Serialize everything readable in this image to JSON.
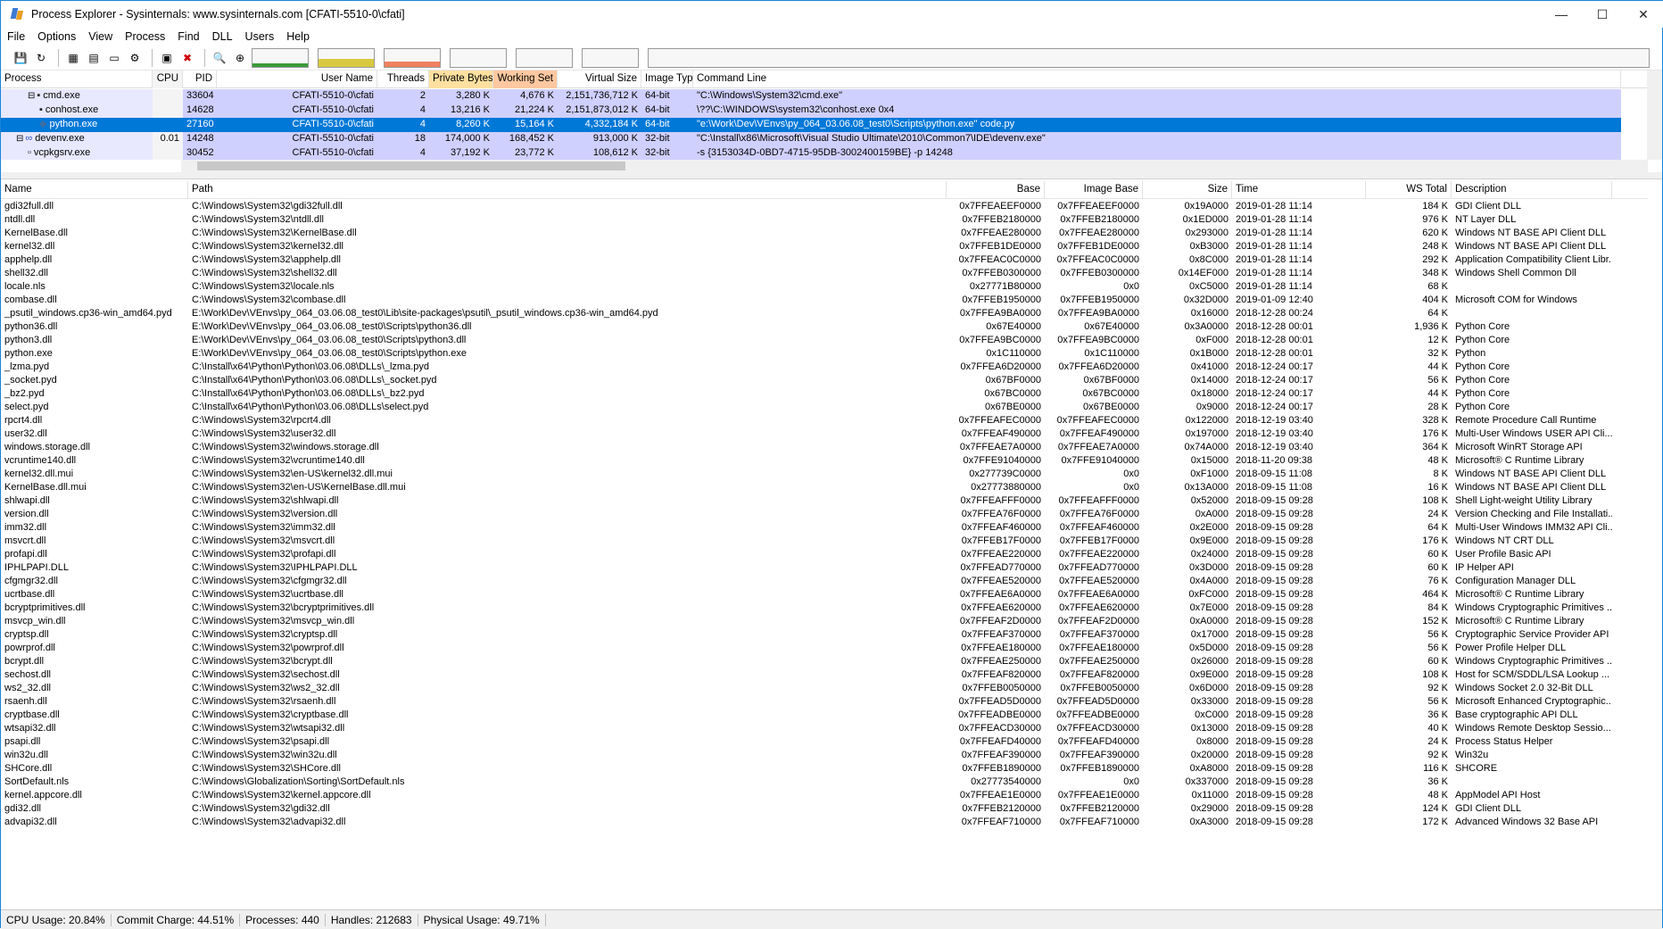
{
  "window": {
    "title": "Process Explorer - Sysinternals: www.sysinternals.com [CFATI-5510-0\\cfati]",
    "minimize": "—",
    "maximize": "☐",
    "close": "✕"
  },
  "menu": [
    "File",
    "Options",
    "View",
    "Process",
    "Find",
    "DLL",
    "Users",
    "Help"
  ],
  "toolbar": {
    "icons": [
      "save-icon",
      "refresh-icon",
      "system-info-icon",
      "properties-icon",
      "window-icon",
      "dll-icon",
      "options-icon",
      "kill-process-icon",
      "find-icon",
      "target-icon"
    ],
    "graphs": [
      {
        "name": "cpu-graph",
        "color": "#3a9a3a",
        "level": 0.2
      },
      {
        "name": "commit-graph",
        "color": "#d8c840",
        "level": 0.45
      },
      {
        "name": "io-graph",
        "color": "#f08060",
        "level": 0.3
      },
      {
        "name": "network-graph",
        "color": "#a0a0a0",
        "level": 0
      },
      {
        "name": "disk-graph",
        "color": "#a0a0a0",
        "level": 0
      },
      {
        "name": "gpu-graph",
        "color": "#a0a0a0",
        "level": 0
      }
    ]
  },
  "process_table": {
    "headers": [
      "Process",
      "CPU",
      "PID",
      "User Name",
      "Threads",
      "Private Bytes",
      "Working Set",
      "Virtual Size",
      "Image Type",
      "Command Line"
    ],
    "rows": [
      {
        "name": "cmd.exe",
        "indent": 2,
        "toggle": "⊟",
        "icon": "cmd-icon",
        "cpu": "",
        "pid": "33604",
        "user": "CFATI-5510-0\\cfati",
        "threads": "2",
        "private": "3,280 K",
        "working": "4,676 K",
        "virtual": "2,151,736,712 K",
        "type": "64-bit",
        "cmd": "\"C:\\Windows\\System32\\cmd.exe\"",
        "style": "purple"
      },
      {
        "name": "conhost.exe",
        "indent": 3,
        "toggle": "",
        "icon": "console-icon",
        "cpu": "",
        "pid": "14628",
        "user": "CFATI-5510-0\\cfati",
        "threads": "4",
        "private": "13,216 K",
        "working": "21,224 K",
        "virtual": "2,151,873,012 K",
        "type": "64-bit",
        "cmd": "\\??\\C:\\WINDOWS\\system32\\conhost.exe 0x4",
        "style": "purple"
      },
      {
        "name": "python.exe",
        "indent": 3,
        "toggle": "",
        "icon": "python-icon",
        "cpu": "",
        "pid": "27160",
        "user": "CFATI-5510-0\\cfati",
        "threads": "4",
        "private": "8,260 K",
        "working": "15,164 K",
        "virtual": "4,332,184 K",
        "type": "64-bit",
        "cmd": "\"e:\\Work\\Dev\\VEnvs\\py_064_03.06.08_test0\\Scripts\\python.exe\"  code.py",
        "style": "selected"
      },
      {
        "name": "devenv.exe",
        "indent": 1,
        "toggle": "⊟",
        "icon": "vs-icon",
        "cpu": "0.01",
        "pid": "14248",
        "user": "CFATI-5510-0\\cfati",
        "threads": "18",
        "private": "174,000 K",
        "working": "168,452 K",
        "virtual": "913,000 K",
        "type": "32-bit",
        "cmd": "\"C:\\Install\\x86\\Microsoft\\Visual Studio Ultimate\\2010\\Common7\\IDE\\devenv.exe\"",
        "style": "purple"
      },
      {
        "name": "vcpkgsrv.exe",
        "indent": 2,
        "toggle": "",
        "icon": "exe-icon",
        "cpu": "",
        "pid": "30452",
        "user": "CFATI-5510-0\\cfati",
        "threads": "4",
        "private": "37,192 K",
        "working": "23,772 K",
        "virtual": "108,612 K",
        "type": "32-bit",
        "cmd": "-s {3153034D-0BD7-4715-95DB-3002400159BE} -p 14248",
        "style": "purple"
      },
      {
        "name": "devenv.exe",
        "indent": 1,
        "toggle": "⊟",
        "icon": "vs2-icon",
        "cpu": "",
        "pid": "",
        "user": "",
        "threads": "",
        "private": "",
        "working": "",
        "virtual": "",
        "type": "",
        "cmd": "",
        "style": "purple"
      }
    ]
  },
  "dll_table": {
    "headers": [
      "Name",
      "Path",
      "Base",
      "Image Base",
      "Size",
      "Time",
      "WS Total",
      "Description"
    ],
    "rows": [
      [
        "gdi32full.dll",
        "C:\\Windows\\System32\\gdi32full.dll",
        "0x7FFEAEEF0000",
        "0x7FFEAEEF0000",
        "0x19A000",
        "2019-01-28 11:14",
        "184 K",
        "GDI Client DLL"
      ],
      [
        "ntdll.dll",
        "C:\\Windows\\System32\\ntdll.dll",
        "0x7FFEB2180000",
        "0x7FFEB2180000",
        "0x1ED000",
        "2019-01-28 11:14",
        "976 K",
        "NT Layer DLL"
      ],
      [
        "KernelBase.dll",
        "C:\\Windows\\System32\\KernelBase.dll",
        "0x7FFEAE280000",
        "0x7FFEAE280000",
        "0x293000",
        "2019-01-28 11:14",
        "620 K",
        "Windows NT BASE API Client DLL"
      ],
      [
        "kernel32.dll",
        "C:\\Windows\\System32\\kernel32.dll",
        "0x7FFEB1DE0000",
        "0x7FFEB1DE0000",
        "0xB3000",
        "2019-01-28 11:14",
        "248 K",
        "Windows NT BASE API Client DLL"
      ],
      [
        "apphelp.dll",
        "C:\\Windows\\System32\\apphelp.dll",
        "0x7FFEAC0C0000",
        "0x7FFEAC0C0000",
        "0x8C000",
        "2019-01-28 11:14",
        "292 K",
        "Application Compatibility Client Libr..."
      ],
      [
        "shell32.dll",
        "C:\\Windows\\System32\\shell32.dll",
        "0x7FFEB0300000",
        "0x7FFEB0300000",
        "0x14EF000",
        "2019-01-28 11:14",
        "348 K",
        "Windows Shell Common Dll"
      ],
      [
        "locale.nls",
        "C:\\Windows\\System32\\locale.nls",
        "0x27771B80000",
        "0x0",
        "0xC5000",
        "2019-01-28 11:14",
        "68 K",
        ""
      ],
      [
        "combase.dll",
        "C:\\Windows\\System32\\combase.dll",
        "0x7FFEB1950000",
        "0x7FFEB1950000",
        "0x32D000",
        "2019-01-09 12:40",
        "404 K",
        "Microsoft COM for Windows"
      ],
      [
        "_psutil_windows.cp36-win_amd64.pyd",
        "E:\\Work\\Dev\\VEnvs\\py_064_03.06.08_test0\\Lib\\site-packages\\psutil\\_psutil_windows.cp36-win_amd64.pyd",
        "0x7FFEA9BA0000",
        "0x7FFEA9BA0000",
        "0x16000",
        "2018-12-28 00:24",
        "64 K",
        ""
      ],
      [
        "python36.dll",
        "E:\\Work\\Dev\\VEnvs\\py_064_03.06.08_test0\\Scripts\\python36.dll",
        "0x67E40000",
        "0x67E40000",
        "0x3A0000",
        "2018-12-28 00:01",
        "1,936 K",
        "Python Core"
      ],
      [
        "python3.dll",
        "E:\\Work\\Dev\\VEnvs\\py_064_03.06.08_test0\\Scripts\\python3.dll",
        "0x7FFEA9BC0000",
        "0x7FFEA9BC0000",
        "0xF000",
        "2018-12-28 00:01",
        "12 K",
        "Python Core"
      ],
      [
        "python.exe",
        "E:\\Work\\Dev\\VEnvs\\py_064_03.06.08_test0\\Scripts\\python.exe",
        "0x1C110000",
        "0x1C110000",
        "0x1B000",
        "2018-12-28 00:01",
        "32 K",
        "Python"
      ],
      [
        "_lzma.pyd",
        "C:\\Install\\x64\\Python\\Python\\03.06.08\\DLLs\\_lzma.pyd",
        "0x7FFEA6D20000",
        "0x7FFEA6D20000",
        "0x41000",
        "2018-12-24 00:17",
        "44 K",
        "Python Core"
      ],
      [
        "_socket.pyd",
        "C:\\Install\\x64\\Python\\Python\\03.06.08\\DLLs\\_socket.pyd",
        "0x67BF0000",
        "0x67BF0000",
        "0x14000",
        "2018-12-24 00:17",
        "56 K",
        "Python Core"
      ],
      [
        "_bz2.pyd",
        "C:\\Install\\x64\\Python\\Python\\03.06.08\\DLLs\\_bz2.pyd",
        "0x67BC0000",
        "0x67BC0000",
        "0x18000",
        "2018-12-24 00:17",
        "44 K",
        "Python Core"
      ],
      [
        "select.pyd",
        "C:\\Install\\x64\\Python\\Python\\03.06.08\\DLLs\\select.pyd",
        "0x67BE0000",
        "0x67BE0000",
        "0x9000",
        "2018-12-24 00:17",
        "28 K",
        "Python Core"
      ],
      [
        "rpcrt4.dll",
        "C:\\Windows\\System32\\rpcrt4.dll",
        "0x7FFEAFEC0000",
        "0x7FFEAFEC0000",
        "0x122000",
        "2018-12-19 03:40",
        "328 K",
        "Remote Procedure Call Runtime"
      ],
      [
        "user32.dll",
        "C:\\Windows\\System32\\user32.dll",
        "0x7FFEAF490000",
        "0x7FFEAF490000",
        "0x197000",
        "2018-12-19 03:40",
        "176 K",
        "Multi-User Windows USER API Cli..."
      ],
      [
        "windows.storage.dll",
        "C:\\Windows\\System32\\windows.storage.dll",
        "0x7FFEAE7A0000",
        "0x7FFEAE7A0000",
        "0x74A000",
        "2018-12-19 03:40",
        "364 K",
        "Microsoft WinRT Storage API"
      ],
      [
        "vcruntime140.dll",
        "C:\\Windows\\System32\\vcruntime140.dll",
        "0x7FFE91040000",
        "0x7FFE91040000",
        "0x15000",
        "2018-11-20 09:38",
        "48 K",
        "Microsoft® C Runtime Library"
      ],
      [
        "kernel32.dll.mui",
        "C:\\Windows\\System32\\en-US\\kernel32.dll.mui",
        "0x277739C0000",
        "0x0",
        "0xF1000",
        "2018-09-15 11:08",
        "8 K",
        "Windows NT BASE API Client DLL"
      ],
      [
        "KernelBase.dll.mui",
        "C:\\Windows\\System32\\en-US\\KernelBase.dll.mui",
        "0x27773880000",
        "0x0",
        "0x13A000",
        "2018-09-15 11:08",
        "16 K",
        "Windows NT BASE API Client DLL"
      ],
      [
        "shlwapi.dll",
        "C:\\Windows\\System32\\shlwapi.dll",
        "0x7FFEAFFF0000",
        "0x7FFEAFFF0000",
        "0x52000",
        "2018-09-15 09:28",
        "108 K",
        "Shell Light-weight Utility Library"
      ],
      [
        "version.dll",
        "C:\\Windows\\System32\\version.dll",
        "0x7FFEA76F0000",
        "0x7FFEA76F0000",
        "0xA000",
        "2018-09-15 09:28",
        "24 K",
        "Version Checking and File Installati..."
      ],
      [
        "imm32.dll",
        "C:\\Windows\\System32\\imm32.dll",
        "0x7FFEAF460000",
        "0x7FFEAF460000",
        "0x2E000",
        "2018-09-15 09:28",
        "64 K",
        "Multi-User Windows IMM32 API Cli..."
      ],
      [
        "msvcrt.dll",
        "C:\\Windows\\System32\\msvcrt.dll",
        "0x7FFEB17F0000",
        "0x7FFEB17F0000",
        "0x9E000",
        "2018-09-15 09:28",
        "176 K",
        "Windows NT CRT DLL"
      ],
      [
        "profapi.dll",
        "C:\\Windows\\System32\\profapi.dll",
        "0x7FFEAE220000",
        "0x7FFEAE220000",
        "0x24000",
        "2018-09-15 09:28",
        "60 K",
        "User Profile Basic API"
      ],
      [
        "IPHLPAPI.DLL",
        "C:\\Windows\\System32\\IPHLPAPI.DLL",
        "0x7FFEAD770000",
        "0x7FFEAD770000",
        "0x3D000",
        "2018-09-15 09:28",
        "60 K",
        "IP Helper API"
      ],
      [
        "cfgmgr32.dll",
        "C:\\Windows\\System32\\cfgmgr32.dll",
        "0x7FFEAE520000",
        "0x7FFEAE520000",
        "0x4A000",
        "2018-09-15 09:28",
        "76 K",
        "Configuration Manager DLL"
      ],
      [
        "ucrtbase.dll",
        "C:\\Windows\\System32\\ucrtbase.dll",
        "0x7FFEAE6A0000",
        "0x7FFEAE6A0000",
        "0xFC000",
        "2018-09-15 09:28",
        "464 K",
        "Microsoft® C Runtime Library"
      ],
      [
        "bcryptprimitives.dll",
        "C:\\Windows\\System32\\bcryptprimitives.dll",
        "0x7FFEAE620000",
        "0x7FFEAE620000",
        "0x7E000",
        "2018-09-15 09:28",
        "84 K",
        "Windows Cryptographic Primitives ..."
      ],
      [
        "msvcp_win.dll",
        "C:\\Windows\\System32\\msvcp_win.dll",
        "0x7FFEAF2D0000",
        "0x7FFEAF2D0000",
        "0xA0000",
        "2018-09-15 09:28",
        "152 K",
        "Microsoft® C Runtime Library"
      ],
      [
        "cryptsp.dll",
        "C:\\Windows\\System32\\cryptsp.dll",
        "0x7FFEAF370000",
        "0x7FFEAF370000",
        "0x17000",
        "2018-09-15 09:28",
        "56 K",
        "Cryptographic Service Provider API"
      ],
      [
        "powrprof.dll",
        "C:\\Windows\\System32\\powrprof.dll",
        "0x7FFEAE180000",
        "0x7FFEAE180000",
        "0x5D000",
        "2018-09-15 09:28",
        "56 K",
        "Power Profile Helper DLL"
      ],
      [
        "bcrypt.dll",
        "C:\\Windows\\System32\\bcrypt.dll",
        "0x7FFEAE250000",
        "0x7FFEAE250000",
        "0x26000",
        "2018-09-15 09:28",
        "60 K",
        "Windows Cryptographic Primitives ..."
      ],
      [
        "sechost.dll",
        "C:\\Windows\\System32\\sechost.dll",
        "0x7FFEAF820000",
        "0x7FFEAF820000",
        "0x9E000",
        "2018-09-15 09:28",
        "108 K",
        "Host for SCM/SDDL/LSA Lookup ..."
      ],
      [
        "ws2_32.dll",
        "C:\\Windows\\System32\\ws2_32.dll",
        "0x7FFEB0050000",
        "0x7FFEB0050000",
        "0x6D000",
        "2018-09-15 09:28",
        "92 K",
        "Windows Socket 2.0 32-Bit DLL"
      ],
      [
        "rsaenh.dll",
        "C:\\Windows\\System32\\rsaenh.dll",
        "0x7FFEAD5D0000",
        "0x7FFEAD5D0000",
        "0x33000",
        "2018-09-15 09:28",
        "56 K",
        "Microsoft Enhanced Cryptographic..."
      ],
      [
        "cryptbase.dll",
        "C:\\Windows\\System32\\cryptbase.dll",
        "0x7FFEADBE0000",
        "0x7FFEADBE0000",
        "0xC000",
        "2018-09-15 09:28",
        "36 K",
        "Base cryptographic API DLL"
      ],
      [
        "wtsapi32.dll",
        "C:\\Windows\\System32\\wtsapi32.dll",
        "0x7FFEACD30000",
        "0x7FFEACD30000",
        "0x13000",
        "2018-09-15 09:28",
        "40 K",
        "Windows Remote Desktop Sessio..."
      ],
      [
        "psapi.dll",
        "C:\\Windows\\System32\\psapi.dll",
        "0x7FFEAFD40000",
        "0x7FFEAFD40000",
        "0x8000",
        "2018-09-15 09:28",
        "24 K",
        "Process Status Helper"
      ],
      [
        "win32u.dll",
        "C:\\Windows\\System32\\win32u.dll",
        "0x7FFEAF390000",
        "0x7FFEAF390000",
        "0x20000",
        "2018-09-15 09:28",
        "92 K",
        "Win32u"
      ],
      [
        "SHCore.dll",
        "C:\\Windows\\System32\\SHCore.dll",
        "0x7FFEB1890000",
        "0x7FFEB1890000",
        "0xA8000",
        "2018-09-15 09:28",
        "116 K",
        "SHCORE"
      ],
      [
        "SortDefault.nls",
        "C:\\Windows\\Globalization\\Sorting\\SortDefault.nls",
        "0x27773540000",
        "0x0",
        "0x337000",
        "2018-09-15 09:28",
        "36 K",
        ""
      ],
      [
        "kernel.appcore.dll",
        "C:\\Windows\\System32\\kernel.appcore.dll",
        "0x7FFEAE1E0000",
        "0x7FFEAE1E0000",
        "0x11000",
        "2018-09-15 09:28",
        "48 K",
        "AppModel API Host"
      ],
      [
        "gdi32.dll",
        "C:\\Windows\\System32\\gdi32.dll",
        "0x7FFEB2120000",
        "0x7FFEB2120000",
        "0x29000",
        "2018-09-15 09:28",
        "124 K",
        "GDI Client DLL"
      ],
      [
        "advapi32.dll",
        "C:\\Windows\\System32\\advapi32.dll",
        "0x7FFEAF710000",
        "0x7FFEAF710000",
        "0xA3000",
        "2018-09-15 09:28",
        "172 K",
        "Advanced Windows 32 Base API"
      ]
    ]
  },
  "status": [
    "CPU Usage: 20.84%",
    "Commit Charge: 44.51%",
    "Processes: 440",
    "Handles: 212683",
    "Physical Usage: 49.71%"
  ],
  "colors": {
    "purple_row": "#d0d0ff",
    "selected_row": "#0078d7",
    "private_bytes_col": "#ffe0a0",
    "working_set_col": "#ffc8a0"
  }
}
